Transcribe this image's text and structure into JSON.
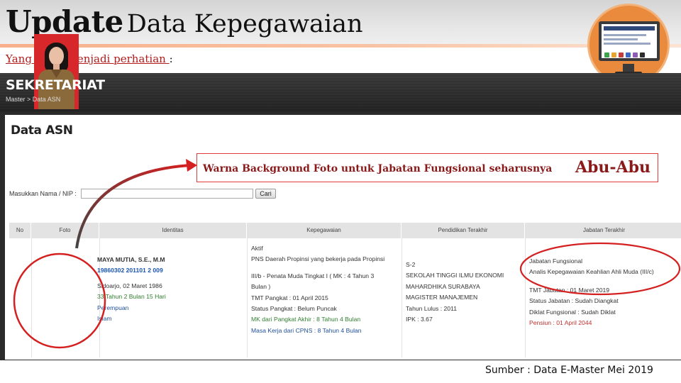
{
  "slide": {
    "title_bold": "Update",
    "title_rest": "Data Kepegawaian",
    "subtitle": "Yang perlu menjadi perhatian ",
    "subtitle_colon": ":",
    "source": "Sumber : Data E-Master Mei 2019"
  },
  "app": {
    "title": "SEKRETARIAT",
    "breadcrumb": "Master > Data ASN",
    "panel_title": "Data ASN",
    "search": {
      "label": "Masukkan Nama / NIP :",
      "value": "",
      "placeholder": "",
      "button": "Cari"
    },
    "columns": [
      "No",
      "Foto",
      "Identitas",
      "Kepegawaian",
      "Pendidikan Terakhir",
      "Jabatan Terakhir"
    ],
    "row": {
      "identitas": {
        "name": "MAYA MUTIA, S.E., M.M",
        "nip": "19860302 201101 2 009",
        "birth": "Sidoarjo, 02 Maret 1986",
        "age": "33 Tahun 2 Bulan 15 Hari",
        "gender": "Perempuan",
        "religion": "Islam"
      },
      "kepegawaian": {
        "status": "Aktif",
        "instansi": "PNS Daerah Propinsi yang bekerja pada Propinsi",
        "pangkat_1": "III/b - Penata Muda Tingkat I ( MK : 4 Tahun 3",
        "pangkat_2": "Bulan )",
        "tmt_pangkat": "TMT Pangkat : 01 April 2015",
        "status_pangkat": "Status Pangkat : Belum Puncak",
        "mk_pangkat": "MK dari Pangkat Akhir : 8 Tahun 4 Bulan",
        "masa_kerja": "Masa Kerja dari CPNS : 8 Tahun 4 Bulan"
      },
      "pendidikan": {
        "jenjang": "S-2",
        "sekolah_1": "SEKOLAH TINGGI ILMU EKONOMI",
        "sekolah_2": "MAHARDHIKA SURABAYA",
        "jurusan": "MAGISTER MANAJEMEN",
        "lulus": "Tahun Lulus : 2011",
        "ipk": "IPK : 3.67"
      },
      "jabatan": {
        "jenis": "Jabatan Fungsional",
        "nama": "Analis Kepegawaian Keahlian Ahli Muda (III/c)",
        "tmt": "TMT Jabatan : 01 Maret 2019",
        "status": "Status Jabatan : Sudah Diangkat",
        "diklat": "Diklat Fungsional : Sudah Diklat",
        "pensiun": "Pensiun : 01 April 2044"
      }
    }
  },
  "annotation": {
    "note": "Warna Background Foto untuk Jabatan Fungsional seharusnya",
    "highlight": "Abu-Abu",
    "color": "#e03a3a"
  }
}
